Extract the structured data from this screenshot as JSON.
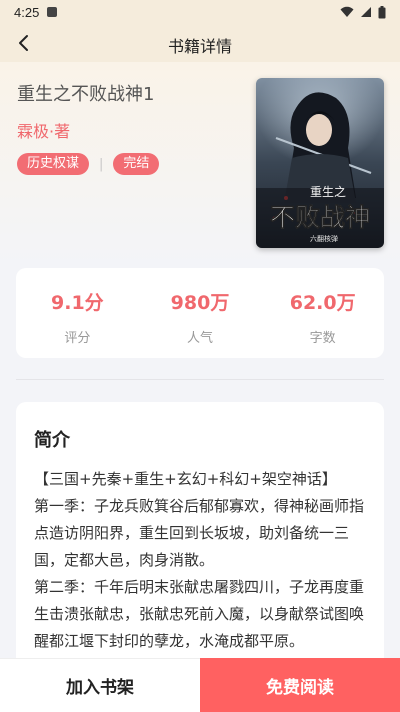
{
  "status_bar": {
    "time": "4:25"
  },
  "nav": {
    "title": "书籍详情"
  },
  "book": {
    "title": "重生之不败战神1",
    "author": "霖极·著",
    "tags": [
      "历史权谋",
      "完结"
    ],
    "cover_title_line1": "重生之",
    "cover_title_line2": "不败战神",
    "cover_author": "六翻核弹"
  },
  "stats": [
    {
      "value": "9.1分",
      "label": "评分"
    },
    {
      "value": "980万",
      "label": "人气"
    },
    {
      "value": "62.0万",
      "label": "字数"
    }
  ],
  "intro": {
    "heading": "简介",
    "paragraphs": [
      "【三国+先秦+重生+玄幻+科幻+架空神话】",
      "第一季：子龙兵败箕谷后郁郁寡欢，得神秘画师指点造访阴阳界，重生回到长坂坡，助刘备统一三国，定都大邑，肉身消散。",
      "第二季：千年后明末张献忠屠戮四川，子龙再度重生击溃张献忠，张献忠死前入魔，以身献祭试图唤醒都江堰下封印的孽龙，水淹成都平原。"
    ]
  },
  "actions": {
    "add_shelf": "加入书架",
    "read_free": "免费阅读"
  },
  "colors": {
    "accent": "#f0686d",
    "read_button": "#ff6161",
    "header_bg": "#f5ecdc"
  }
}
